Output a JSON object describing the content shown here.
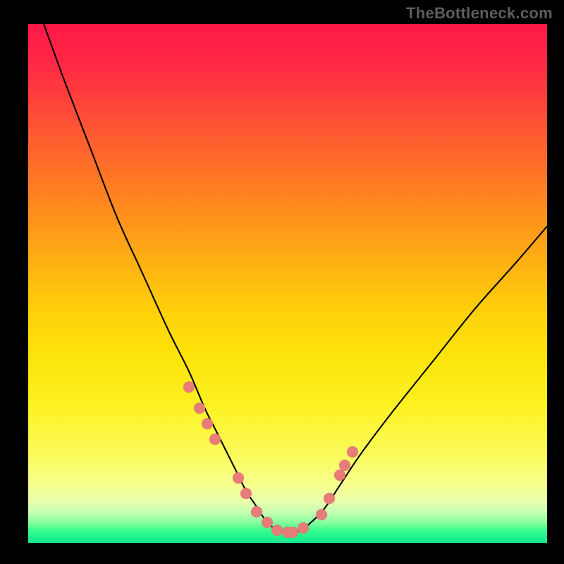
{
  "watermark": "TheBottleneck.com",
  "chart_data": {
    "type": "line",
    "title": "",
    "xlabel": "",
    "ylabel": "",
    "xlim": [
      0,
      100
    ],
    "ylim": [
      0,
      100
    ],
    "grid": false,
    "legend": false,
    "series": [
      {
        "name": "curve",
        "x": [
          3,
          7,
          12,
          17,
          22,
          27,
          31,
          34,
          36,
          38,
          40,
          42,
          44,
          46,
          48,
          50,
          52,
          54,
          57,
          60,
          64,
          70,
          78,
          86,
          94,
          100
        ],
        "y": [
          100,
          89,
          76,
          63,
          52,
          41,
          33,
          26,
          22,
          18,
          14,
          10,
          7,
          4,
          2.5,
          2,
          2.2,
          3.5,
          6.5,
          11,
          17,
          25,
          35,
          45,
          54,
          61
        ]
      }
    ],
    "points": {
      "name": "markers",
      "color": "#e77c79",
      "x": [
        31,
        33,
        34.5,
        36,
        40.5,
        42,
        44,
        46,
        48,
        50,
        51,
        53,
        56.5,
        58,
        60,
        61,
        62.5
      ],
      "y": [
        30,
        26,
        23,
        20,
        12.5,
        9.5,
        6,
        4,
        2.5,
        2,
        2,
        2.8,
        5.5,
        8.5,
        13,
        15,
        17.5
      ]
    },
    "background": {
      "type": "vertical-gradient",
      "stops": [
        {
          "pos": 0,
          "color": "#ff1846"
        },
        {
          "pos": 50,
          "color": "#ffc60f"
        },
        {
          "pos": 85,
          "color": "#fcfc6a"
        },
        {
          "pos": 97,
          "color": "#3dfd8e"
        },
        {
          "pos": 100,
          "color": "#1ae88e"
        }
      ]
    }
  }
}
